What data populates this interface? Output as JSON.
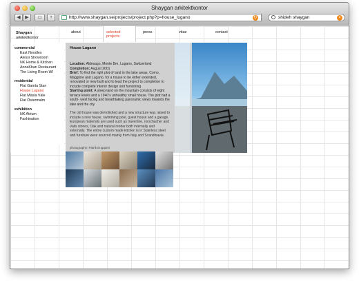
{
  "window": {
    "title": "Shaygan arkitektkontor"
  },
  "toolbar": {
    "back": "◀",
    "forward": "▶",
    "view": "▭",
    "add": "+"
  },
  "address": {
    "url": "http://www.shaygan.se/projects/project.php?p=house_lugano"
  },
  "search": {
    "value": "shideh shaygan"
  },
  "site": {
    "logo_line1": "Shaygan",
    "logo_line2": "arkitektkontor"
  },
  "nav": {
    "items": [
      {
        "label": "about"
      },
      {
        "label": "selected projects"
      },
      {
        "label": "press"
      },
      {
        "label": "vitae"
      },
      {
        "label": "contact"
      }
    ]
  },
  "sidebar": {
    "sections": [
      {
        "title": "commercial",
        "items": [
          "East Noodles",
          "Alessi Showroom",
          "NK Home & Kitchen",
          "AnnaKhan Restaurant",
          "The Living Room WI"
        ]
      },
      {
        "title": "residential",
        "items": [
          "Flat Gamla Stan",
          "House Lugano",
          "Flat Mäsla Väle",
          "Flat Östermalm"
        ]
      },
      {
        "title": "exhibition",
        "items": [
          "NK Atrium",
          "Fashination"
        ]
      }
    ],
    "active_item": "House Lugano"
  },
  "project": {
    "title": "House Lugano",
    "location_label": "Location:",
    "location": "Aldesago, Monte Bre, Lugano, Switzerland",
    "completion_label": "Completion:",
    "completion": "August 2001",
    "brief_label": "Brief:",
    "brief": "To find the right plot of land in the lake areas, Como, Maggiore and Lugano, for a house to be either extended, renovated or new built and to lead the project to completion to include complete interior design and furnishing",
    "starting_label": "Starting point:",
    "starting": "A steep land on the mountain consists of eight terrace levels and a 1940's unhealthy small house. The plot had a south- west facing and breathtaking panoramic views towards the lake and the city",
    "description": "The old house was demolished and a new structure was raised to include a new house, swimming pool, guest house and a garage. European materials are used such as travertine, rorschacher and Valis stones, Oak and natural render both internally and externally. The entire custom made kitchen is in Stainless steel and furniture were sourced mainly from Italy and Scandinavia.",
    "photo_credit": "photography: Patrik Engquist"
  },
  "colors": {
    "accent": "#e63a1e",
    "panel": "#d0d0d0",
    "grid": "#e6e6e6"
  }
}
